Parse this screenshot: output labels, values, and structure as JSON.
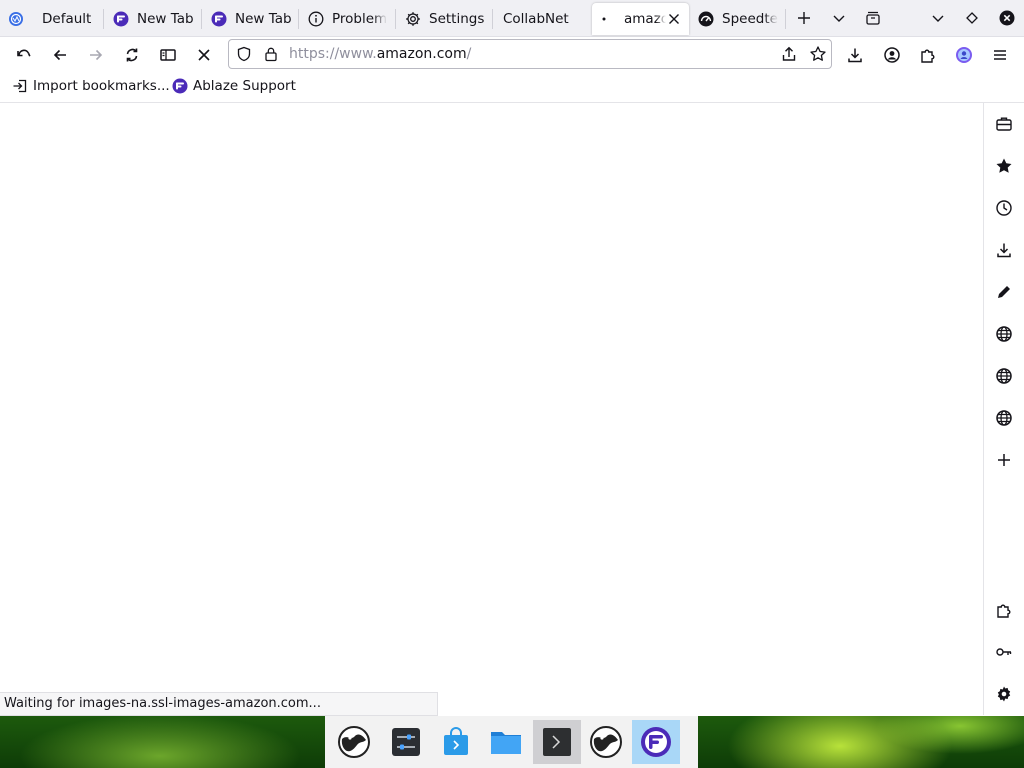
{
  "tabs": [
    {
      "label": "Default",
      "icon": "browser-logo-icon"
    },
    {
      "label": "New Tab",
      "icon": "ablaze-logo-icon"
    },
    {
      "label": "New Tab",
      "icon": "ablaze-logo-icon"
    },
    {
      "label": "Problem",
      "icon": "info-icon"
    },
    {
      "label": "Settings",
      "icon": "gear-icon"
    },
    {
      "label": "CollabNet",
      "icon": ""
    },
    {
      "label": "amazo",
      "icon": "loading-dot-icon",
      "active": true
    },
    {
      "label": "Speedtes",
      "icon": "speedtest-icon"
    }
  ],
  "url": {
    "prefix": "https://www.",
    "domain": "amazon.com",
    "suffix": "/"
  },
  "bookmarks": [
    {
      "label": "Import bookmarks...",
      "icon": "import-icon"
    },
    {
      "label": "Ablaze Support",
      "icon": "ablaze-logo-icon"
    }
  ],
  "status": {
    "text": "Waiting for images-na.ssl-images-amazon.com..."
  },
  "colors": {
    "accent": "#5b3fd1",
    "tab_strip_bg": "#f0f0f4",
    "url_border": "#b9b9c2",
    "dock_selected": "#a9d7f7"
  }
}
